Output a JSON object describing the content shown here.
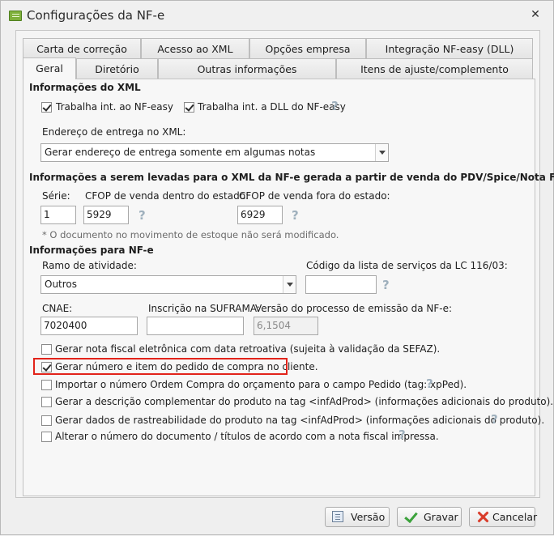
{
  "window": {
    "title": "Configurações da NF-e",
    "close_glyph": "✕",
    "app_icon": "nfe-app-icon"
  },
  "tabs_row1": [
    "Carta de correção",
    "Acesso ao XML",
    "Opções empresa",
    "Integração NF-easy (DLL)"
  ],
  "tabs_row2": [
    "Geral",
    "Diretório",
    "Outras informações",
    "Itens de ajuste/complemento"
  ],
  "active_tab": "Geral",
  "xml_info": {
    "title": "Informações do XML",
    "chk_nfeasy": "Trabalha int. ao NF-easy",
    "chk_nfeasy_checked": true,
    "chk_dll": "Trabalha int. a DLL do NF-easy",
    "chk_dll_checked": true,
    "help": "?",
    "endereco_label": "Endereço de entrega no XML:",
    "endereco_value": "Gerar endereço de entrega somente em algumas notas"
  },
  "pdv_info": {
    "title": "Informações a serem levadas para o XML da NF-e gerada a partir de venda do PDV/Spice/Nota Fácil",
    "serie_label": "Série:",
    "serie_value": "1",
    "cfop_dentro_label": "CFOP de venda dentro do estado:",
    "cfop_dentro_value": "5929",
    "cfop_fora_label": "CFOP de venda fora do estado:",
    "cfop_fora_value": "6929",
    "note": "* O documento no movimento de estoque não será modificado."
  },
  "nfe_info": {
    "title": "Informações para NF-e",
    "ramo_label": "Ramo de atividade:",
    "ramo_value": "Outros",
    "codigo_label": "Código da lista de serviços da LC 116/03:",
    "codigo_value": "",
    "cnae_label": "CNAE:",
    "cnae_value": "7020400",
    "suframa_label": "Inscrição na SUFRAMA:",
    "suframa_value": "",
    "versao_label": "Versão do processo de emissão da NF-e:",
    "versao_value": "6,1504"
  },
  "options": [
    {
      "label": "Gerar nota fiscal eletrônica com data retroativa (sujeita à validação da SEFAZ).",
      "checked": false,
      "help": false
    },
    {
      "label": "Gerar número e item do pedido de compra no cliente.",
      "checked": true,
      "help": false
    },
    {
      "label": "Importar o número Ordem Compra do orçamento para o campo Pedido (tag: xpPed).",
      "checked": false,
      "help": true
    },
    {
      "label": "Gerar a descrição complementar do produto na tag <infAdProd> (informações adicionais do produto).",
      "checked": false,
      "help": false
    },
    {
      "label": "Gerar dados de rastreabilidade do produto na tag <infAdProd> (informações adicionais do produto).",
      "checked": false,
      "help": true
    },
    {
      "label": "Alterar o número do documento / títulos de acordo com a nota fiscal impressa.",
      "checked": false,
      "help": true
    }
  ],
  "buttons": {
    "versao": "Versão",
    "gravar": "Gravar",
    "cancelar": "Cancelar"
  },
  "colors": {
    "highlight": "#e2231a",
    "help_icon": "#9fb0bd",
    "gravar_check": "#3ca23c",
    "cancel_x": "#d93c2a"
  }
}
